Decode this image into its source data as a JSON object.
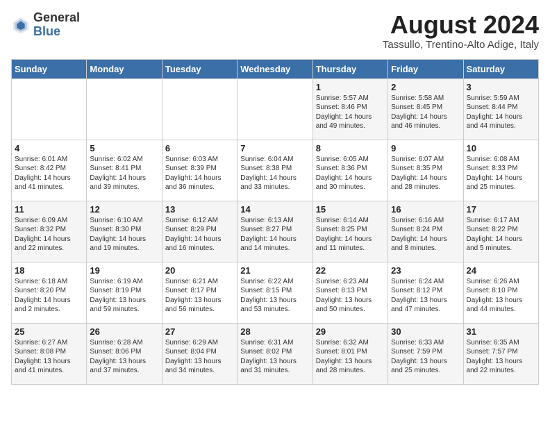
{
  "logo": {
    "general": "General",
    "blue": "Blue"
  },
  "title": {
    "month_year": "August 2024",
    "location": "Tassullo, Trentino-Alto Adige, Italy"
  },
  "weekdays": [
    "Sunday",
    "Monday",
    "Tuesday",
    "Wednesday",
    "Thursday",
    "Friday",
    "Saturday"
  ],
  "weeks": [
    [
      {
        "day": "",
        "sunrise": "",
        "sunset": "",
        "daylight": ""
      },
      {
        "day": "",
        "sunrise": "",
        "sunset": "",
        "daylight": ""
      },
      {
        "day": "",
        "sunrise": "",
        "sunset": "",
        "daylight": ""
      },
      {
        "day": "",
        "sunrise": "",
        "sunset": "",
        "daylight": ""
      },
      {
        "day": "1",
        "sunrise": "Sunrise: 5:57 AM",
        "sunset": "Sunset: 8:46 PM",
        "daylight": "Daylight: 14 hours and 49 minutes."
      },
      {
        "day": "2",
        "sunrise": "Sunrise: 5:58 AM",
        "sunset": "Sunset: 8:45 PM",
        "daylight": "Daylight: 14 hours and 46 minutes."
      },
      {
        "day": "3",
        "sunrise": "Sunrise: 5:59 AM",
        "sunset": "Sunset: 8:44 PM",
        "daylight": "Daylight: 14 hours and 44 minutes."
      }
    ],
    [
      {
        "day": "4",
        "sunrise": "Sunrise: 6:01 AM",
        "sunset": "Sunset: 8:42 PM",
        "daylight": "Daylight: 14 hours and 41 minutes."
      },
      {
        "day": "5",
        "sunrise": "Sunrise: 6:02 AM",
        "sunset": "Sunset: 8:41 PM",
        "daylight": "Daylight: 14 hours and 39 minutes."
      },
      {
        "day": "6",
        "sunrise": "Sunrise: 6:03 AM",
        "sunset": "Sunset: 8:39 PM",
        "daylight": "Daylight: 14 hours and 36 minutes."
      },
      {
        "day": "7",
        "sunrise": "Sunrise: 6:04 AM",
        "sunset": "Sunset: 8:38 PM",
        "daylight": "Daylight: 14 hours and 33 minutes."
      },
      {
        "day": "8",
        "sunrise": "Sunrise: 6:05 AM",
        "sunset": "Sunset: 8:36 PM",
        "daylight": "Daylight: 14 hours and 30 minutes."
      },
      {
        "day": "9",
        "sunrise": "Sunrise: 6:07 AM",
        "sunset": "Sunset: 8:35 PM",
        "daylight": "Daylight: 14 hours and 28 minutes."
      },
      {
        "day": "10",
        "sunrise": "Sunrise: 6:08 AM",
        "sunset": "Sunset: 8:33 PM",
        "daylight": "Daylight: 14 hours and 25 minutes."
      }
    ],
    [
      {
        "day": "11",
        "sunrise": "Sunrise: 6:09 AM",
        "sunset": "Sunset: 8:32 PM",
        "daylight": "Daylight: 14 hours and 22 minutes."
      },
      {
        "day": "12",
        "sunrise": "Sunrise: 6:10 AM",
        "sunset": "Sunset: 8:30 PM",
        "daylight": "Daylight: 14 hours and 19 minutes."
      },
      {
        "day": "13",
        "sunrise": "Sunrise: 6:12 AM",
        "sunset": "Sunset: 8:29 PM",
        "daylight": "Daylight: 14 hours and 16 minutes."
      },
      {
        "day": "14",
        "sunrise": "Sunrise: 6:13 AM",
        "sunset": "Sunset: 8:27 PM",
        "daylight": "Daylight: 14 hours and 14 minutes."
      },
      {
        "day": "15",
        "sunrise": "Sunrise: 6:14 AM",
        "sunset": "Sunset: 8:25 PM",
        "daylight": "Daylight: 14 hours and 11 minutes."
      },
      {
        "day": "16",
        "sunrise": "Sunrise: 6:16 AM",
        "sunset": "Sunset: 8:24 PM",
        "daylight": "Daylight: 14 hours and 8 minutes."
      },
      {
        "day": "17",
        "sunrise": "Sunrise: 6:17 AM",
        "sunset": "Sunset: 8:22 PM",
        "daylight": "Daylight: 14 hours and 5 minutes."
      }
    ],
    [
      {
        "day": "18",
        "sunrise": "Sunrise: 6:18 AM",
        "sunset": "Sunset: 8:20 PM",
        "daylight": "Daylight: 14 hours and 2 minutes."
      },
      {
        "day": "19",
        "sunrise": "Sunrise: 6:19 AM",
        "sunset": "Sunset: 8:19 PM",
        "daylight": "Daylight: 13 hours and 59 minutes."
      },
      {
        "day": "20",
        "sunrise": "Sunrise: 6:21 AM",
        "sunset": "Sunset: 8:17 PM",
        "daylight": "Daylight: 13 hours and 56 minutes."
      },
      {
        "day": "21",
        "sunrise": "Sunrise: 6:22 AM",
        "sunset": "Sunset: 8:15 PM",
        "daylight": "Daylight: 13 hours and 53 minutes."
      },
      {
        "day": "22",
        "sunrise": "Sunrise: 6:23 AM",
        "sunset": "Sunset: 8:13 PM",
        "daylight": "Daylight: 13 hours and 50 minutes."
      },
      {
        "day": "23",
        "sunrise": "Sunrise: 6:24 AM",
        "sunset": "Sunset: 8:12 PM",
        "daylight": "Daylight: 13 hours and 47 minutes."
      },
      {
        "day": "24",
        "sunrise": "Sunrise: 6:26 AM",
        "sunset": "Sunset: 8:10 PM",
        "daylight": "Daylight: 13 hours and 44 minutes."
      }
    ],
    [
      {
        "day": "25",
        "sunrise": "Sunrise: 6:27 AM",
        "sunset": "Sunset: 8:08 PM",
        "daylight": "Daylight: 13 hours and 41 minutes."
      },
      {
        "day": "26",
        "sunrise": "Sunrise: 6:28 AM",
        "sunset": "Sunset: 8:06 PM",
        "daylight": "Daylight: 13 hours and 37 minutes."
      },
      {
        "day": "27",
        "sunrise": "Sunrise: 6:29 AM",
        "sunset": "Sunset: 8:04 PM",
        "daylight": "Daylight: 13 hours and 34 minutes."
      },
      {
        "day": "28",
        "sunrise": "Sunrise: 6:31 AM",
        "sunset": "Sunset: 8:02 PM",
        "daylight": "Daylight: 13 hours and 31 minutes."
      },
      {
        "day": "29",
        "sunrise": "Sunrise: 6:32 AM",
        "sunset": "Sunset: 8:01 PM",
        "daylight": "Daylight: 13 hours and 28 minutes."
      },
      {
        "day": "30",
        "sunrise": "Sunrise: 6:33 AM",
        "sunset": "Sunset: 7:59 PM",
        "daylight": "Daylight: 13 hours and 25 minutes."
      },
      {
        "day": "31",
        "sunrise": "Sunrise: 6:35 AM",
        "sunset": "Sunset: 7:57 PM",
        "daylight": "Daylight: 13 hours and 22 minutes."
      }
    ]
  ]
}
